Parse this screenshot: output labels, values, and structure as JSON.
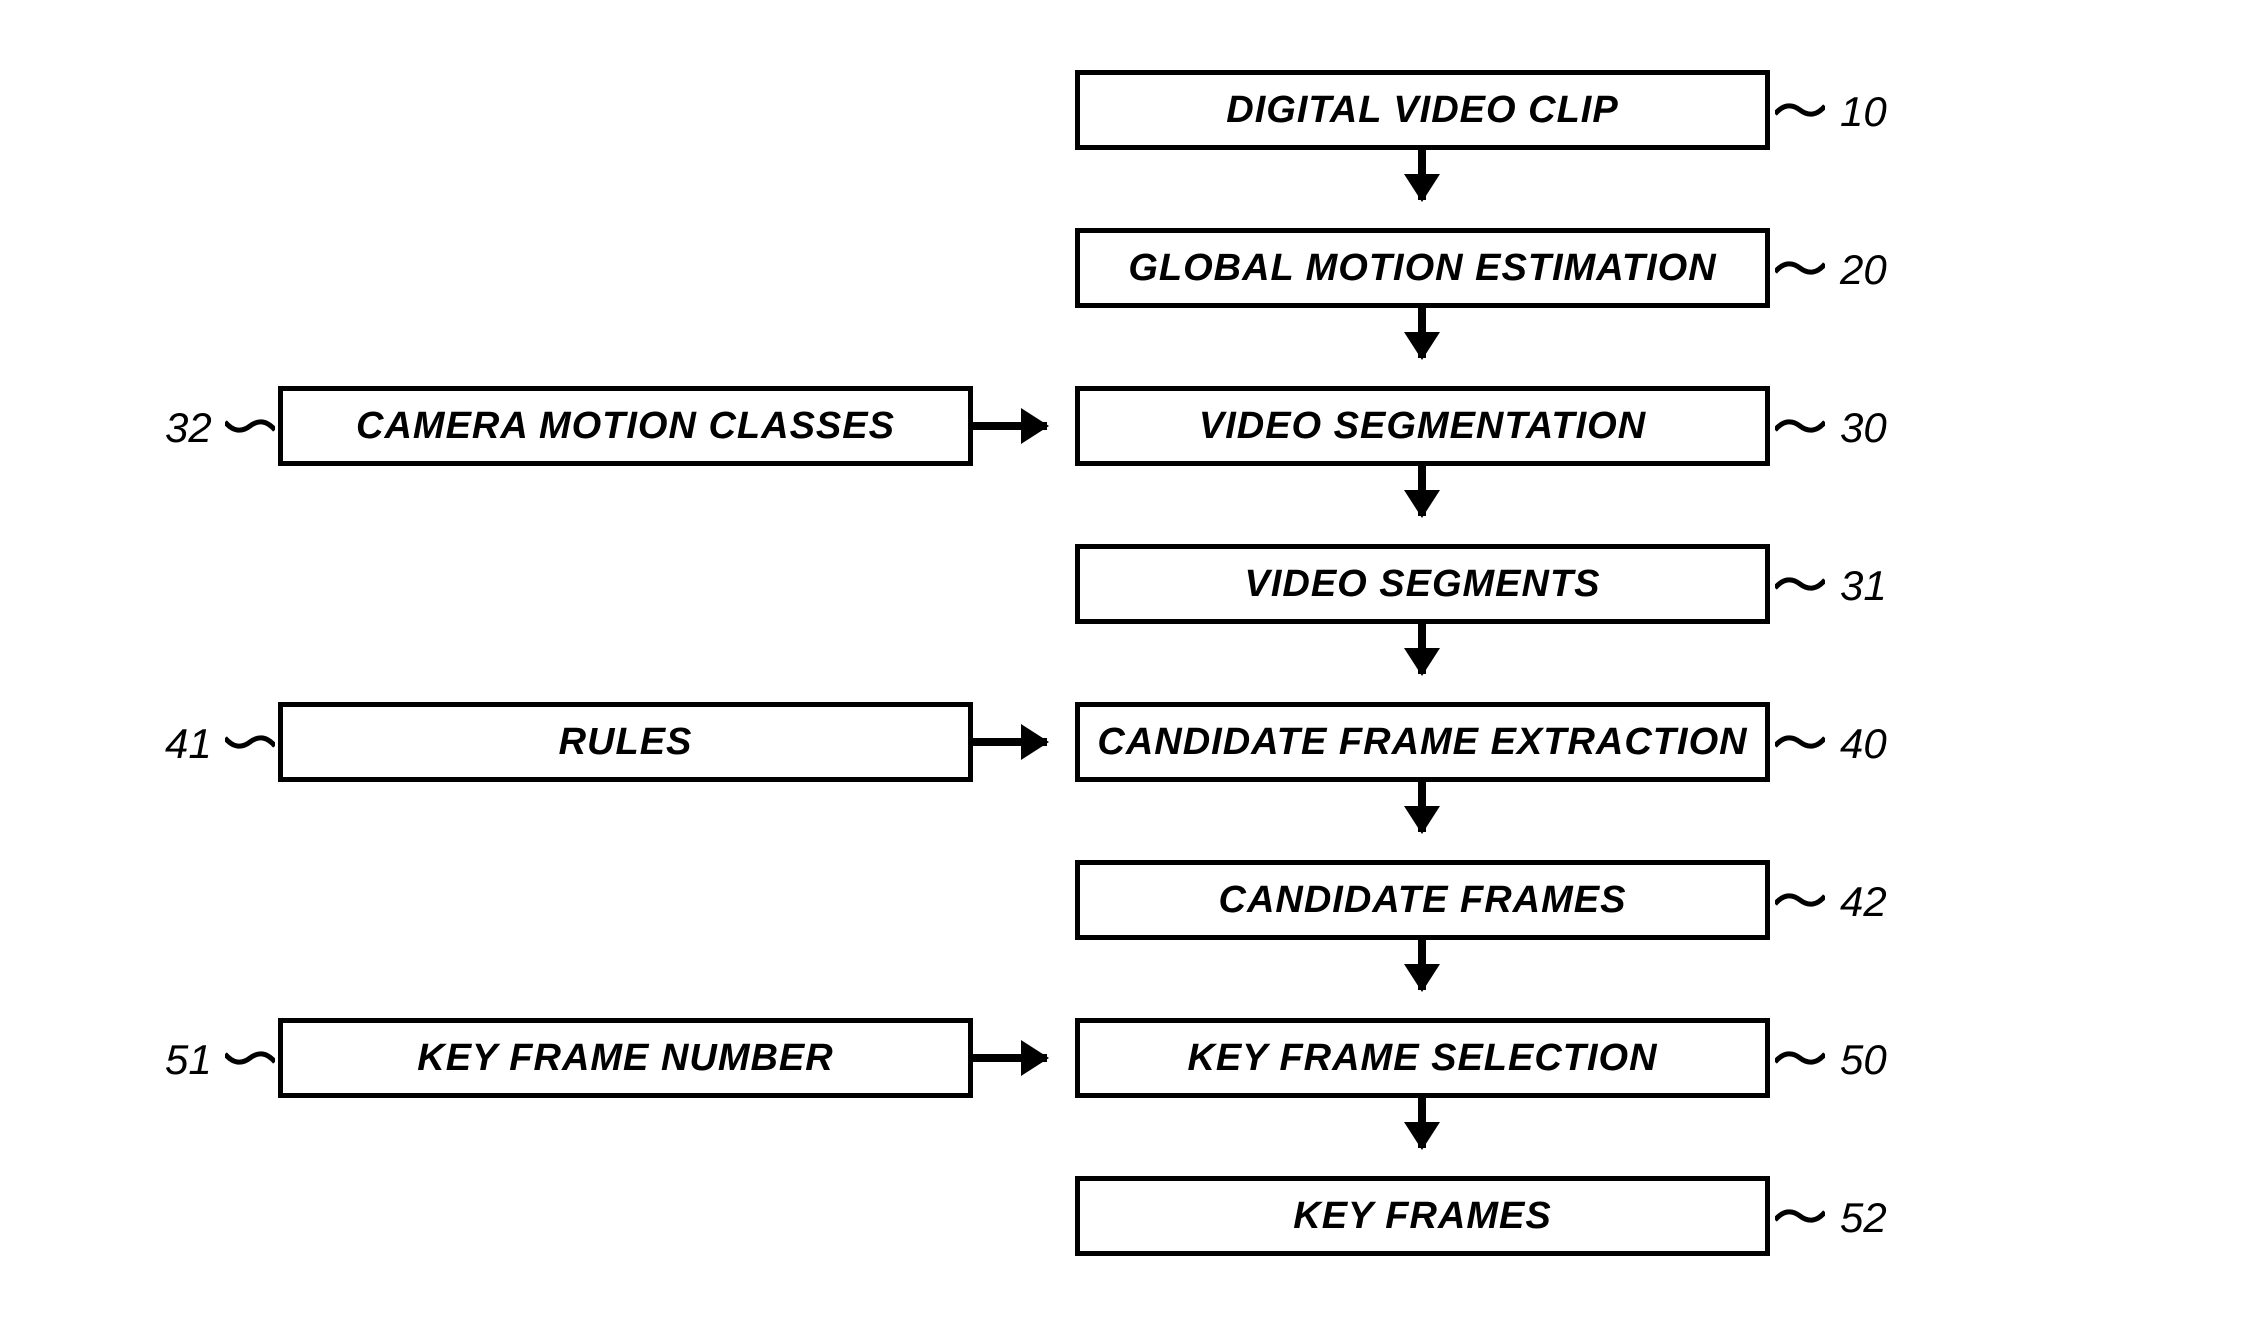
{
  "main": [
    {
      "label": "DIGITAL VIDEO CLIP",
      "ref": "10"
    },
    {
      "label": "GLOBAL MOTION ESTIMATION",
      "ref": "20"
    },
    {
      "label": "VIDEO SEGMENTATION",
      "ref": "30"
    },
    {
      "label": "VIDEO SEGMENTS",
      "ref": "31"
    },
    {
      "label": "CANDIDATE FRAME EXTRACTION",
      "ref": "40"
    },
    {
      "label": "CANDIDATE FRAMES",
      "ref": "42"
    },
    {
      "label": "KEY FRAME SELECTION",
      "ref": "50"
    },
    {
      "label": "KEY FRAMES",
      "ref": "52"
    }
  ],
  "side": [
    {
      "label": "CAMERA MOTION CLASSES",
      "ref": "32"
    },
    {
      "label": "RULES",
      "ref": "41"
    },
    {
      "label": "KEY FRAME NUMBER",
      "ref": "51"
    }
  ]
}
